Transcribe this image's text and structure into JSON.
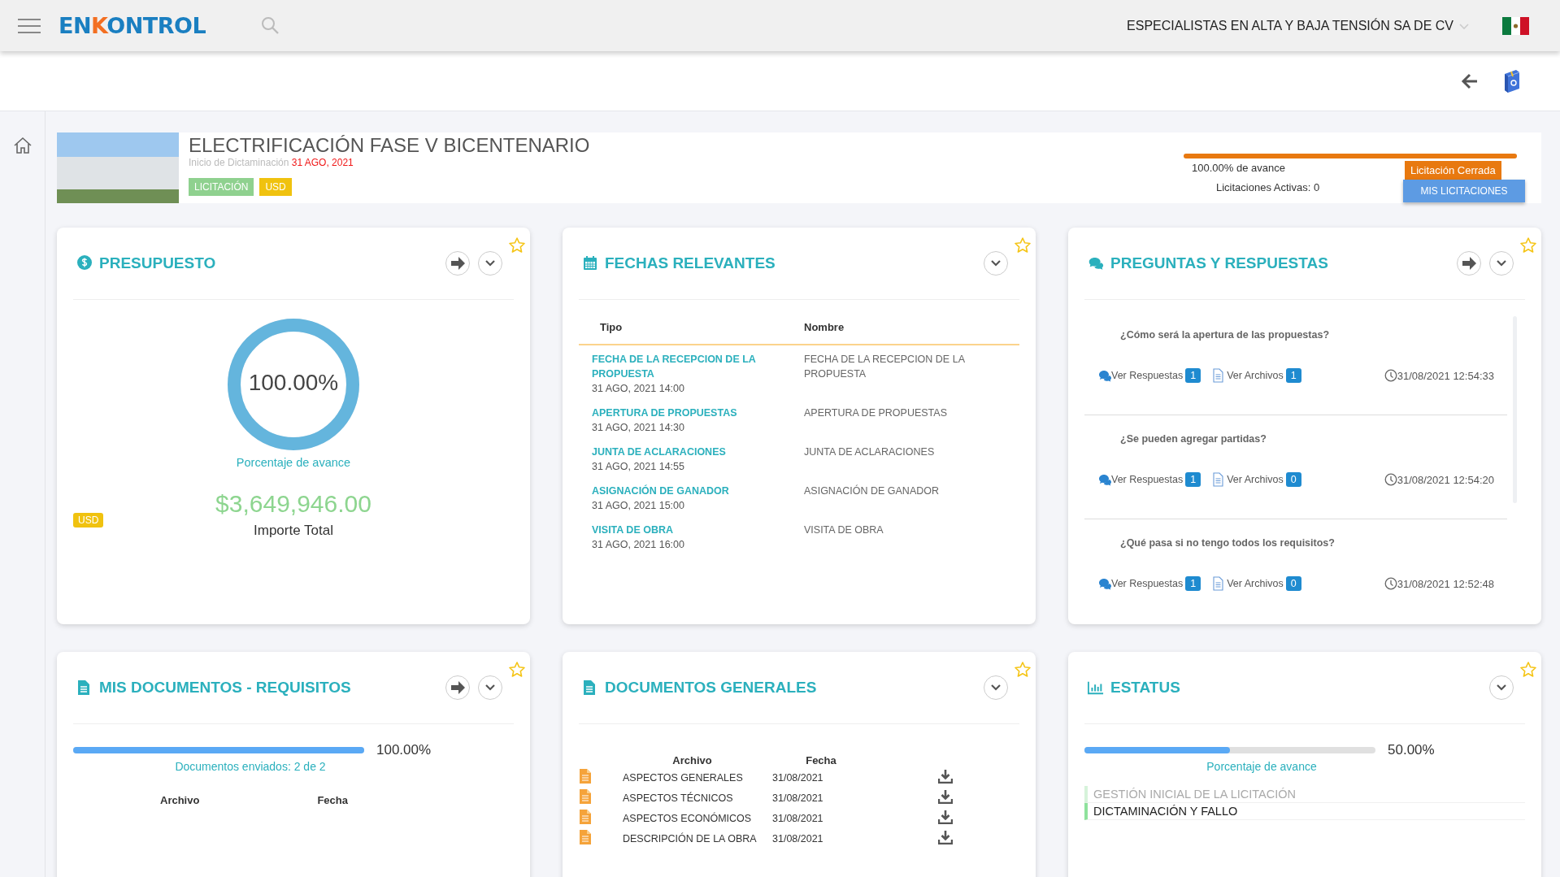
{
  "header": {
    "logo": "ENKONTROL",
    "company": "ESPECIALISTAS EN ALTA Y BAJA TENSIÓN SA DE CV"
  },
  "project": {
    "title": "ELECTRIFICACIÓN FASE V BICENTENARIO",
    "start_label": "Inicio de Dictaminación",
    "start_date": "31 AGO, 2021",
    "tags": [
      {
        "label": "LICITACIÓN",
        "color": "#8fd18f"
      },
      {
        "label": "USD",
        "color": "#f0c20f"
      }
    ],
    "progress": {
      "level": 1,
      "reading": "100.00% de avance"
    },
    "state_badge": "Licitación Cerrada",
    "active_count": "Licitaciones Activas: 0",
    "button": "MIS LICITACIONES"
  },
  "cards": [
    {
      "kind": "budget",
      "title": "PRESUPUESTO",
      "forward_button": true,
      "favorite": false,
      "donut": {
        "level": 1,
        "reading": "100.00%"
      },
      "caption": "Porcentaje de avance",
      "currency": "USD",
      "amount": "$3,649,946.00",
      "amount_label": "Importe Total"
    },
    {
      "kind": "dates",
      "title": "FECHAS RELEVANTES",
      "forward_button": false,
      "favorite": false,
      "columns": [
        "Tipo",
        "Nombre"
      ],
      "rows": [
        {
          "type": "FECHA DE LA RECEPCION DE LA PROPUESTA",
          "date": "31 AGO, 2021 14:00",
          "name": "FECHA DE LA RECEPCION DE LA PROPUESTA"
        },
        {
          "type": "APERTURA DE PROPUESTAS",
          "date": "31 AGO, 2021 14:30",
          "name": "APERTURA DE PROPUESTAS"
        },
        {
          "type": "JUNTA DE ACLARACIONES",
          "date": "31 AGO, 2021 14:55",
          "name": "JUNTA DE ACLARACIONES"
        },
        {
          "type": "ASIGNACIÓN DE GANADOR",
          "date": "31 AGO, 2021 15:00",
          "name": "ASIGNACIÓN DE GANADOR"
        },
        {
          "type": "VISITA DE OBRA",
          "date": "31 AGO, 2021 16:00",
          "name": "VISITA DE OBRA"
        }
      ]
    },
    {
      "kind": "qa",
      "title": "PREGUNTAS Y RESPUESTAS",
      "forward_button": true,
      "favorite": false,
      "items": [
        {
          "question": "¿Cómo será la apertura de las propuestas?",
          "answers_label": "Ver Respuestas",
          "answers": "1",
          "files_label": "Ver Archivos",
          "files": "1",
          "time": "31/08/2021 12:54:33"
        },
        {
          "question": "¿Se pueden agregar partidas?",
          "answers_label": "Ver Respuestas",
          "answers": "1",
          "files_label": "Ver Archivos",
          "files": "0",
          "time": "31/08/2021 12:54:20"
        },
        {
          "question": "¿Qué pasa si no tengo todos los requisitos?",
          "answers_label": "Ver Respuestas",
          "answers": "1",
          "files_label": "Ver Archivos",
          "files": "0",
          "time": "31/08/2021 12:52:48"
        }
      ]
    },
    {
      "kind": "mydocs",
      "title": "MIS DOCUMENTOS - REQUISITOS",
      "forward_button": true,
      "favorite": false,
      "progress": {
        "level": 1,
        "reading": "100.00%"
      },
      "caption": "Documentos enviados: 2 de 2",
      "columns": [
        "Archivo",
        "Fecha"
      ]
    },
    {
      "kind": "gendocs",
      "title": "DOCUMENTOS GENERALES",
      "forward_button": false,
      "favorite": false,
      "columns": [
        "Archivo",
        "Fecha"
      ],
      "rows": [
        {
          "name": "ASPECTOS GENERALES",
          "date": "31/08/2021"
        },
        {
          "name": "ASPECTOS TÉCNICOS",
          "date": "31/08/2021"
        },
        {
          "name": "ASPECTOS ECONÓMICOS",
          "date": "31/08/2021"
        },
        {
          "name": "DESCRIPCIÓN DE LA OBRA",
          "date": "31/08/2021"
        }
      ]
    },
    {
      "kind": "status",
      "title": "ESTATUS",
      "forward_button": false,
      "favorite": false,
      "progress": {
        "level": 0.5,
        "reading": "50.00%"
      },
      "caption": "Porcentaje de avance",
      "stages": [
        {
          "label": "GESTIÓN INICIAL DE LA LICITACIÓN",
          "active": false
        },
        {
          "label": "DICTAMINACIÓN Y FALLO",
          "active": true
        }
      ]
    }
  ]
}
